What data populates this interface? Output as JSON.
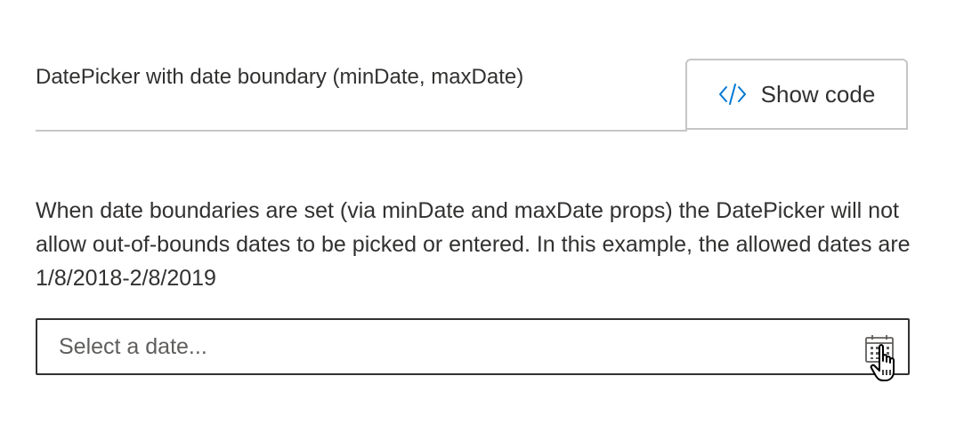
{
  "example": {
    "title": "DatePicker with date boundary (minDate, maxDate)",
    "show_code_label": "Show code",
    "description": "When date boundaries are set (via minDate and maxDate props) the DatePicker will not allow out-of-bounds dates to be picked or entered. In this example, the allowed dates are 1/8/2018-2/8/2019"
  },
  "date_picker": {
    "placeholder": "Select a date...",
    "value": ""
  },
  "icons": {
    "show_code": "code-icon",
    "calendar": "calendar-icon",
    "cursor": "hand-pointer-cursor"
  },
  "colors": {
    "accent": "#0078d4",
    "text": "#323130",
    "border": "#c8c6c4"
  }
}
